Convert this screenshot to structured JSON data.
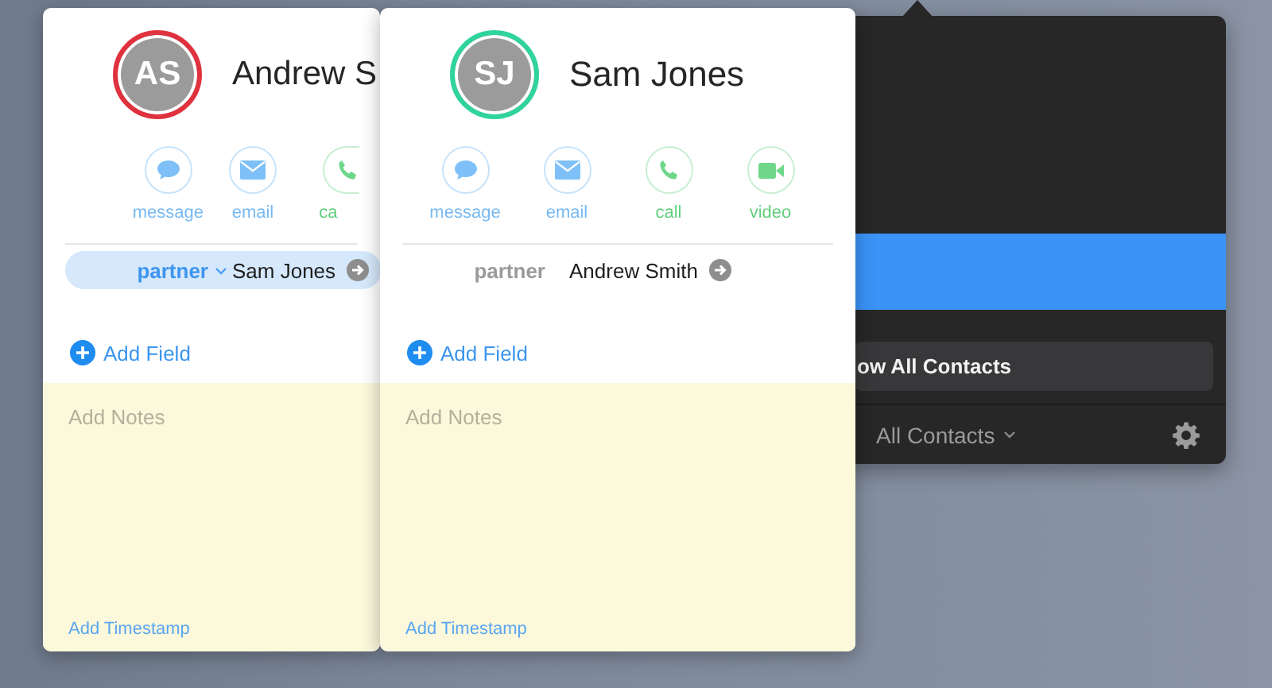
{
  "contacts_panel": {
    "rows": [
      {
        "selected": true
      }
    ],
    "show_all_button": "ow All Contacts",
    "group_menu": "All Contacts"
  },
  "cards": [
    {
      "initials": "AS",
      "color": "#e0323e",
      "name": "Andrew S",
      "actions": [
        {
          "kind": "message",
          "label": "message"
        },
        {
          "kind": "email",
          "label": "email"
        },
        {
          "kind": "call",
          "label": "ca"
        }
      ],
      "field": {
        "label": "partner",
        "value": "Sam Jones",
        "selected": true
      },
      "add_field": "Add Field",
      "notes": {
        "placeholder": "Add Notes"
      },
      "timestamp": "Add Timestamp"
    },
    {
      "initials": "SJ",
      "color": "#2fd49b",
      "name": "Sam Jones",
      "actions": [
        {
          "kind": "message",
          "label": "message"
        },
        {
          "kind": "email",
          "label": "email"
        },
        {
          "kind": "call",
          "label": "call"
        },
        {
          "kind": "video",
          "label": "video"
        }
      ],
      "field": {
        "label": "partner",
        "value": "Andrew Smith",
        "selected": false
      },
      "add_field": "Add Field",
      "notes": {
        "placeholder": "Add Notes"
      },
      "timestamp": "Add Timestamp"
    }
  ]
}
